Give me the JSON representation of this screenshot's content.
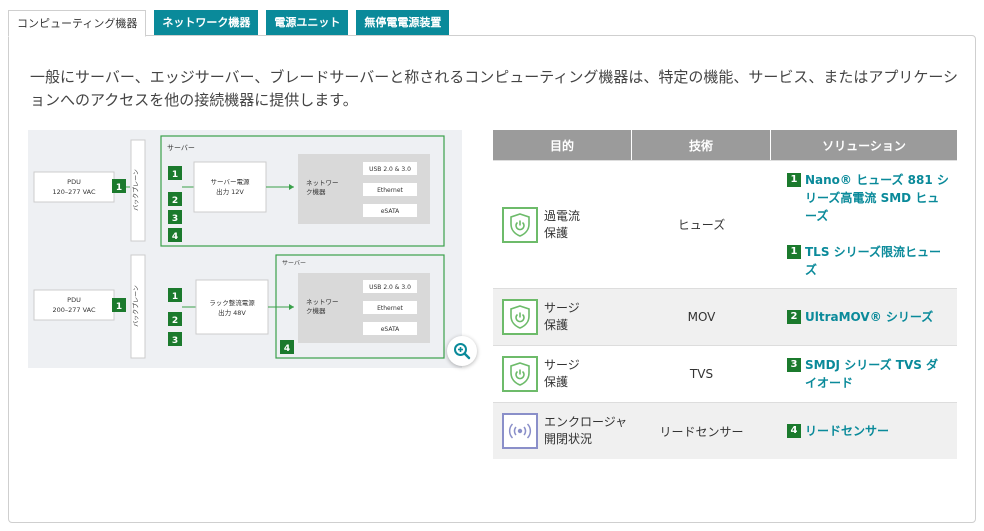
{
  "tabs": [
    {
      "label": "コンピューティング機器",
      "active": true
    },
    {
      "label": "ネットワーク機器",
      "active": false
    },
    {
      "label": "電源ユニット",
      "active": false
    },
    {
      "label": "無停電電源装置",
      "active": false
    }
  ],
  "intro": "一般にサーバー、エッジサーバー、ブレードサーバーと称されるコンピューティング機器は、特定の機能、サービス、またはアプリケーションへのアクセスを他の接続機器に提供します。",
  "colors": {
    "accent": "#0a8a9a",
    "number_badge": "#1b7a2d",
    "diagram_green": "#3aa04a",
    "header_gray": "#9b9b9b"
  },
  "diagram": {
    "top": {
      "pdu": [
        "PDU",
        "120–277 VAC"
      ],
      "backplane": "バックプレーン",
      "server_label": "サーバー",
      "psu": [
        "サーバー電源",
        "出力 12V"
      ],
      "network": [
        "ネットワー",
        "ク機器"
      ],
      "ports": [
        "USB 2.0 & 3.0",
        "Ethernet",
        "eSATA"
      ],
      "badges": [
        "1",
        "1",
        "2",
        "3",
        "4"
      ]
    },
    "bottom": {
      "pdu": [
        "PDU",
        "200–277 VAC"
      ],
      "backplane": "バックプレーン",
      "server_label": "サーバー",
      "psu": [
        "ラック整流電源",
        "出力 48V"
      ],
      "network": [
        "ネットワー",
        "ク機器"
      ],
      "ports": [
        "USB 2.0 & 3.0",
        "Ethernet",
        "eSATA"
      ],
      "badges": [
        "1",
        "1",
        "2",
        "3",
        "4"
      ]
    },
    "zoom_icon": "zoom-in-icon"
  },
  "table": {
    "headers": [
      "目的",
      "技術",
      "ソリューション"
    ],
    "rows": [
      {
        "icon": "shield-power-icon",
        "purpose": [
          "過電流",
          "保護"
        ],
        "tech": "ヒューズ",
        "solutions": [
          {
            "num": "1",
            "text": "Nano® ヒューズ 881 シリーズ高電流 SMD ヒューズ"
          },
          {
            "num": "1",
            "text": "TLS シリーズ限流ヒューズ"
          }
        ]
      },
      {
        "icon": "shield-power-icon",
        "purpose": [
          "サージ",
          "保護"
        ],
        "tech": "MOV",
        "solutions": [
          {
            "num": "2",
            "text": "UltraMOV® シリーズ"
          }
        ]
      },
      {
        "icon": "shield-power-icon",
        "purpose": [
          "サージ",
          "保護"
        ],
        "tech": "TVS",
        "solutions": [
          {
            "num": "3",
            "text": "SMDJ シリーズ TVS ダイオード"
          }
        ]
      },
      {
        "icon": "sensor-signal-icon",
        "purpose": [
          "エンクロージャ",
          "開閉状況"
        ],
        "tech": "リードセンサー",
        "solutions": [
          {
            "num": "4",
            "text": "リードセンサー"
          }
        ]
      }
    ]
  }
}
